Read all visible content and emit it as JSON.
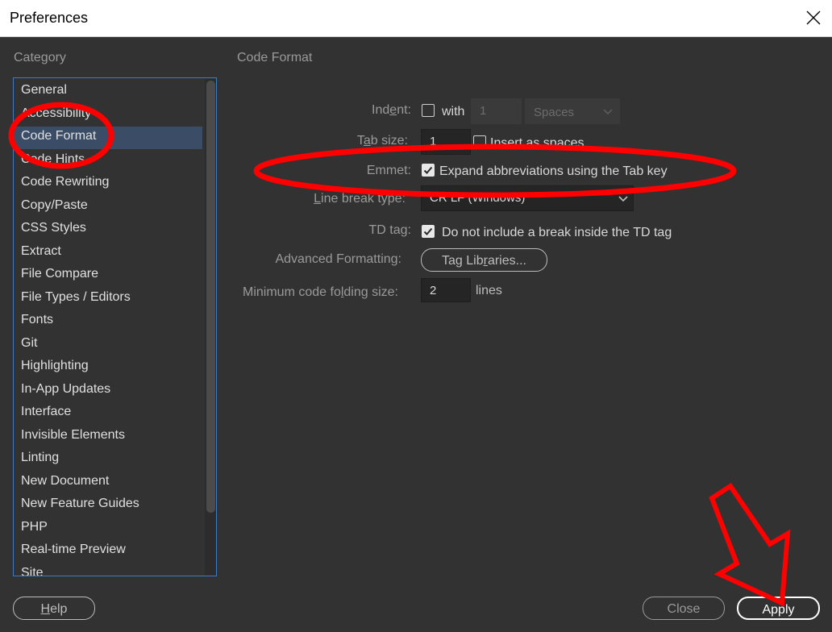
{
  "window": {
    "title": "Preferences"
  },
  "category": {
    "heading": "Category",
    "items": [
      "General",
      "Accessibility",
      "Code Format",
      "Code Hints",
      "Code Rewriting",
      "Copy/Paste",
      "CSS Styles",
      "Extract",
      "File Compare",
      "File Types / Editors",
      "Fonts",
      "Git",
      "Highlighting",
      "In-App Updates",
      "Interface",
      "Invisible Elements",
      "Linting",
      "New Document",
      "New Feature Guides",
      "PHP",
      "Real-time Preview",
      "Site"
    ],
    "selected": "Code Format"
  },
  "panel": {
    "heading": "Code Format",
    "indent": {
      "label_pre": "Ind",
      "label_u": "e",
      "label_post": "nt:",
      "with_label": "with",
      "value": "1",
      "unit": "Spaces",
      "checked": false
    },
    "tab_size": {
      "label_pre": "T",
      "label_u": "a",
      "label_post": "b size:",
      "value": "1",
      "insert_label": "Insert as spaces",
      "checked": false
    },
    "emmet": {
      "label": "Emmet:",
      "checkbox_label": "Expand abbreviations using the Tab key",
      "checked": true
    },
    "line_break": {
      "label_pre": "",
      "label_u": "L",
      "label_post": "ine break type:",
      "value": "CR LF (Windows)"
    },
    "td_tag": {
      "label": "TD tag:",
      "checkbox_label": "Do not include a break inside the TD tag",
      "checked": true
    },
    "advanced": {
      "label": "Advanced Formatting:",
      "button_pre": "Tag Lib",
      "button_u": "r",
      "button_post": "aries..."
    },
    "folding": {
      "label_pre": "Minimum code fo",
      "label_u": "l",
      "label_post": "ding size:",
      "value": "2",
      "unit": "lines"
    }
  },
  "buttons": {
    "help_u": "H",
    "help_rest": "elp",
    "close": "Close",
    "apply": "Apply"
  },
  "colors": {
    "annotation": "#ff0000",
    "selection": "#3b4d66",
    "accent": "#3d7bc4"
  }
}
